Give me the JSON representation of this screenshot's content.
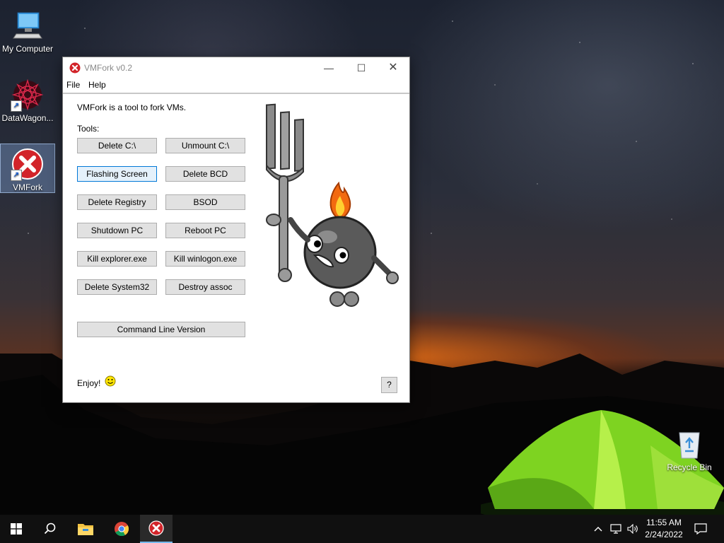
{
  "desktop": {
    "icons": [
      {
        "label": "My Computer",
        "icon": "computer-icon"
      },
      {
        "label": "DataWagon...",
        "icon": "datawagon-icon"
      },
      {
        "label": "VMFork",
        "icon": "vmfork-icon"
      },
      {
        "label": "Recycle Bin",
        "icon": "recycle-bin-icon"
      }
    ]
  },
  "window": {
    "title": "VMFork v0.2",
    "controls": {
      "minimize": "—",
      "maximize": "☐",
      "close": "✕"
    },
    "menu": [
      "File",
      "Help"
    ],
    "description": "VMFork is a tool to fork VMs.",
    "tools_label": "Tools:",
    "buttons": [
      "Delete C:\\",
      "Unmount C:\\",
      "Flashing Screen",
      "Delete BCD",
      "Delete Registry",
      "BSOD",
      "Shutdown PC",
      "Reboot PC",
      "Kill explorer.exe",
      "Kill winlogon.exe",
      "Delete System32",
      "Destroy assoc"
    ],
    "cli_button": "Command Line Version",
    "footer_text": "Enjoy!",
    "help_button": "?",
    "colors": {
      "accent": "#0078d7",
      "error_red": "#d2242a"
    }
  },
  "taskbar": {
    "clock_time": "11:55 AM",
    "clock_date": "2/24/2022",
    "items": [
      "start-icon",
      "search-icon",
      "file-explorer-icon",
      "chrome-icon",
      "vmfork-icon"
    ]
  }
}
